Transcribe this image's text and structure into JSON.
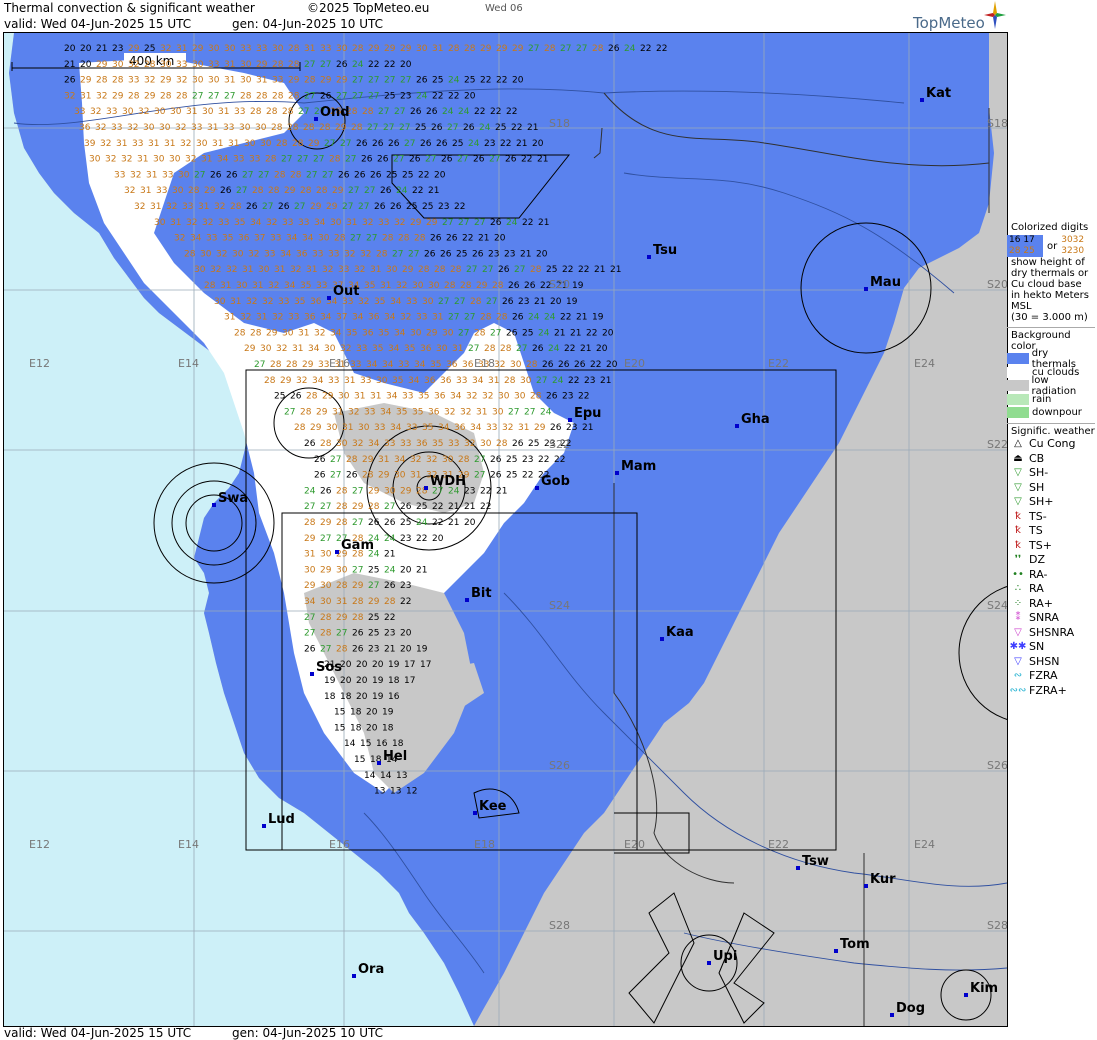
{
  "header": {
    "title": "Thermal convection & significant weather",
    "copyright": "©2025 TopMeteo.eu",
    "tab_day": "Wed 06",
    "valid": "valid:  Wed  04-Jun-2025  15 UTC",
    "generated": "gen: 04-Jun-2025 10 UTC",
    "logo": "TopMeteo"
  },
  "footer": {
    "valid": "valid:  Wed  04-Jun-2025  15 UTC",
    "generated": "gen: 04-Jun-2025 10 UTC"
  },
  "map": {
    "scale_label": "400 km",
    "colors": {
      "ocean": "#cdf0f8",
      "land": "#c8c8c8",
      "dry_thermals": "#5a82ee",
      "cu_clouds": "#ffffff",
      "low_radiation": "#c8c8c8",
      "digit_low": "#000000",
      "digit_mid": "#2e9a2e",
      "digit_high": "#c87818"
    },
    "grid_labels": [
      "E12",
      "E14",
      "E16",
      "E18",
      "E20",
      "E22",
      "E24",
      "E12",
      "E14",
      "E16",
      "E18",
      "E20",
      "E22",
      "E24",
      "S18",
      "S20",
      "S22",
      "S24",
      "S26",
      "S28",
      "S18",
      "S20",
      "S22",
      "S24",
      "S26",
      "S28"
    ],
    "cities": [
      "Ond",
      "Kat",
      "Tsu",
      "Mau",
      "Out",
      "Epu",
      "Gha",
      "Mam",
      "WDH",
      "Gob",
      "Swa",
      "Gam",
      "Bit",
      "Kaa",
      "Sos",
      "Hel",
      "Kee",
      "Lud",
      "Tsw",
      "Kur",
      "Tom",
      "Upi",
      "Ora",
      "Kim",
      "Dog"
    ],
    "digit_rows": [
      "20 20 21 23 29 25 32 31 29 30 30 33 33 30 28 31 33 30 28 29 29 29 30 31 28 28 29 29 29 27 28 27 27 28 26 24 22 22",
      "21 20 29 30 32 28 30 33 30 33 31 30 29 28 28 27 27 26 24 22 22 20",
      "26 29 28 28 33 32 29 32 30 30 31 30 31 33 29 28 29 29 27 27 27 27 26 25 24 25 22 22 20",
      "32 31 32 29 28 29 28 28 27 27 27 28 28 28 28 27 26 27 27 27 25 23 24 22 22 20",
      "33 32 33 30 32 30 30 31 30 31 33 28 28 28 27 27 28 28 28 27 27 26 26 24 24 22 22 22",
      "36 32 33 32 30 30 32 33 31 33 30 30 28 28 28 28 29 28 27 27 27 25 26 27 26 24 25 22 21",
      "39 32 31 33 31 31 32 30 31 31 30 30 28 28 29 27 27 26 26 26 27 26 26 25 24 23 22 21 20",
      "30 32 32 31 30 30 32 31 34 33 33 28 27 27 27 28 27 26 26 27 26 27 26 27 26 27 26 22 21",
      "33 32 31 33 30 27 26 26 27 27 28 28 27 27 26 26 26 25 25 22 20",
      "32 31 33 30 28 29 26 27 28 28 29 28 28 29 27 27 26 24 22 21",
      "32 31 32 33 31 32 28 26 27 26 27 29 29 27 27 26 26 25 25 23 22",
      "30 31 32 32 33 35 34 32 33 33 34 30 31 32 33 32 29 29 27 27 27 26 24 22 21",
      "32 34 33 35 36 37 33 34 34 30 28 27 27 28 28 28 26 26 22 21 20",
      "28 30 32 30 32 33 34 36 33 33 32 32 28 27 27 26 26 25 26 23 23 21 20",
      "30 32 32 31 30 31 32 31 32 33 32 31 30 29 28 28 28 27 27 26 27 28 25 22 22 21 21",
      "28 31 30 31 32 34 35 33 37 34 35 31 32 30 30 28 28 29 28 26 26 22 21 19",
      "30 31 32 32 33 35 36 34 33 32 35 34 33 30 27 27 28 27 26 23 21 20 19",
      "31 32 31 32 33 36 34 37 34 36 34 32 33 31 27 27 28 28 26 24 24 22 21 19",
      "28 28 29 30 31 32 34 35 36 35 34 30 29 30 27 28 27 26 25 24 21 21 22 20",
      "29 30 32 31 34 30 32 33 35 34 35 36 30 31 27 28 28 27 26 24 22 21 20",
      "27 28 28 29 33 31 33 34 34 33 34 35 36 36 33 32 30 28 26 26 26 22 20",
      "28 29 32 34 33 31 33 30 35 34 36 36 33 34 31 28 30 27 24 22 23 21",
      "25 26 28 29 30 31 31 34 33 35 36 34 32 32 30 30 28 26 23 22",
      "27 28 29 31 32 33 34 35 35 36 32 32 31 30 27 27 24",
      "28 29 30 31 30 33 34 33 35 34 36 34 33 32 31 29 26 23 21",
      "26 28 30 32 34 33 33 36 35 33 32 30 28 26 25 23 22",
      "26 27 28 29 31 34 32 32 30 28 27 26 25 23 22 22",
      "26 27 26 28 29 30 31 32 31 29 27 26 25 22 22",
      "24 26 28 27 29 30 29 28 27 24 23 22 21",
      "27 27 28 29 28 27 26 25 22 21 21 22",
      "28 29 28 27 26 26 25 24 22 21 20",
      "29 27 27 28 24 24 23 22 20",
      "31 30 29 28 24 21",
      "30 29 30 27 25 24 20 21",
      "29 30 28 29 27 26 23",
      "34 30 31 28 29 28 22",
      "27 28 29 28 25 22",
      "27 28 27 26 25 23 20",
      "26 27 28 26 23 21 20 19",
      "21 20 20 20 19 17 17",
      "19 20 20 19 18 17",
      "18 18 20 19 16",
      "15 18 20 19",
      "15 18 20 18",
      "14 15 16 18",
      "15 18 14",
      "14 14 13",
      "13 13 12"
    ]
  },
  "legend": {
    "digits_title": [
      "Colorized digits"
    ],
    "digits_sample_a": [
      "16 17",
      "28 25"
    ],
    "or_label": "or",
    "digits_sample_b": [
      "3032",
      "3230"
    ],
    "digits_desc": [
      "show height of",
      "dry thermals or",
      "Cu cloud base",
      "in hekto Meters",
      "MSL",
      "(30 = 3.000 m)"
    ],
    "bg_title": "Background color",
    "bg_items": [
      {
        "label": "dry thermals",
        "color": "#5a82ee"
      },
      {
        "label": "cu clouds",
        "color": "#ffffff"
      },
      {
        "label": "low radiation",
        "color": "#c8c8c8"
      },
      {
        "label": "rain",
        "color": "#b8e8b8"
      },
      {
        "label": "downpour",
        "color": "#90dc90"
      }
    ],
    "sig_title": "Signific. weather",
    "sig_items": [
      {
        "label": "Cu Cong",
        "icon": "cu-cong-icon",
        "glyph": "△",
        "color": "#000000"
      },
      {
        "label": "CB",
        "icon": "cb-icon",
        "glyph": "⏏",
        "color": "#000000"
      },
      {
        "label": "SH-",
        "icon": "shower-light-icon",
        "glyph": "▽",
        "color": "#2e9a2e"
      },
      {
        "label": "SH",
        "icon": "shower-icon",
        "glyph": "▽",
        "color": "#2e9a2e"
      },
      {
        "label": "SH+",
        "icon": "shower-heavy-icon",
        "glyph": "▽",
        "color": "#2e9a2e"
      },
      {
        "label": "TS-",
        "icon": "thunderstorm-light-icon",
        "glyph": "ꝁ",
        "color": "#c02020"
      },
      {
        "label": "TS",
        "icon": "thunderstorm-icon",
        "glyph": "ꝁ",
        "color": "#c02020"
      },
      {
        "label": "TS+",
        "icon": "thunderstorm-heavy-icon",
        "glyph": "ꝁ",
        "color": "#c02020"
      },
      {
        "label": "DZ",
        "icon": "drizzle-icon",
        "glyph": "❜❜",
        "color": "#208020"
      },
      {
        "label": "RA-",
        "icon": "rain-light-icon",
        "glyph": "••",
        "color": "#208020"
      },
      {
        "label": "RA",
        "icon": "rain-icon",
        "glyph": "∴",
        "color": "#208020"
      },
      {
        "label": "RA+",
        "icon": "rain-heavy-icon",
        "glyph": "⁘",
        "color": "#208020"
      },
      {
        "label": "SNRA",
        "icon": "snow-rain-icon",
        "glyph": "⁑",
        "color": "#cc40cc"
      },
      {
        "label": "SHSNRA",
        "icon": "shower-snow-rain-icon",
        "glyph": "▽",
        "color": "#cc40cc"
      },
      {
        "label": "SN",
        "icon": "snow-icon",
        "glyph": "✱✱",
        "color": "#4040ff"
      },
      {
        "label": "SHSN",
        "icon": "shower-snow-icon",
        "glyph": "▽",
        "color": "#4040ff"
      },
      {
        "label": "FZRA",
        "icon": "freezing-rain-icon",
        "glyph": "∾",
        "color": "#20b0d0"
      },
      {
        "label": "FZRA+",
        "icon": "freezing-rain-heavy-icon",
        "glyph": "∾∾",
        "color": "#20b0d0"
      }
    ]
  }
}
